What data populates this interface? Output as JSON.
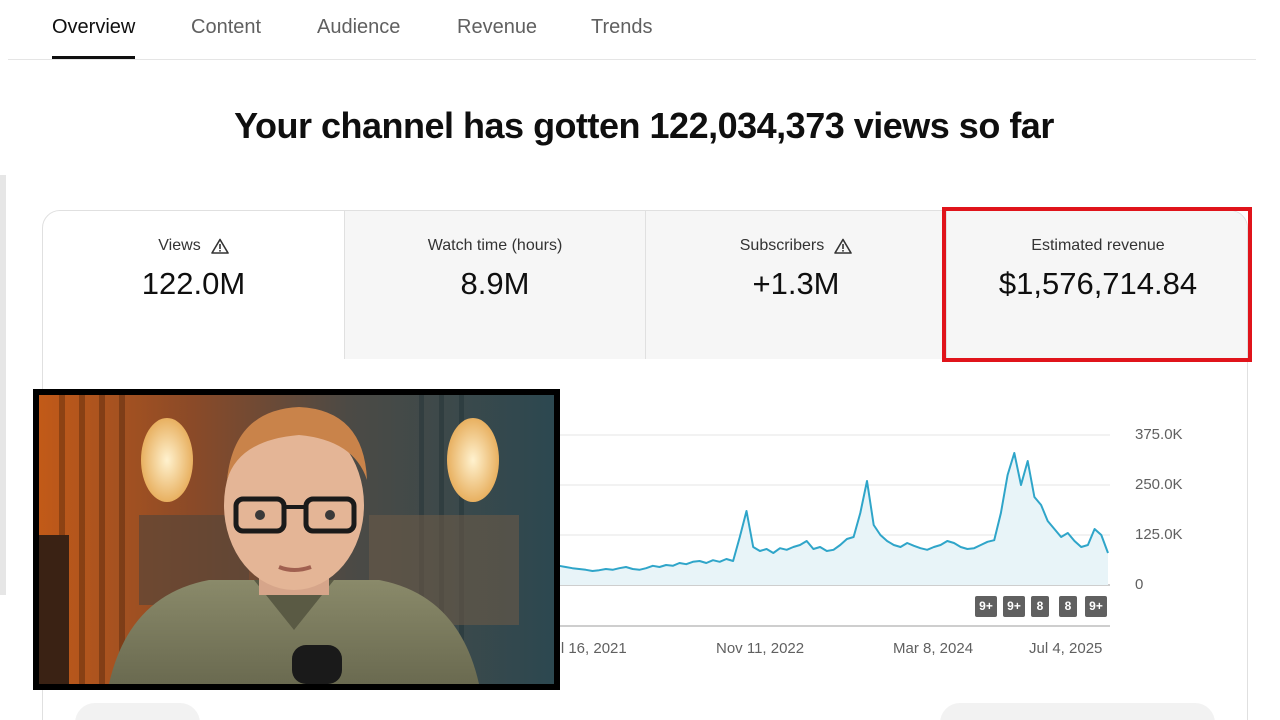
{
  "tabs": [
    {
      "label": "Overview",
      "active": true
    },
    {
      "label": "Content",
      "active": false
    },
    {
      "label": "Audience",
      "active": false
    },
    {
      "label": "Revenue",
      "active": false
    },
    {
      "label": "Trends",
      "active": false
    }
  ],
  "headline": "Your channel has gotten 122,034,373 views so far",
  "metrics": [
    {
      "label": "Views",
      "value": "122.0M",
      "warning": true
    },
    {
      "label": "Watch time (hours)",
      "value": "8.9M",
      "warning": false
    },
    {
      "label": "Subscribers",
      "value": "+1.3M",
      "warning": true
    },
    {
      "label": "Estimated revenue",
      "value": "$1,576,714.84",
      "warning": false
    }
  ],
  "highlight_color": "#e0141b",
  "chart_data": {
    "type": "area",
    "y_ticks": [
      "375.0K",
      "250.0K",
      "125.0K",
      "0"
    ],
    "x_ticks": [
      "Jul 16, 2021",
      "Nov 11, 2022",
      "Mar 8, 2024",
      "Jul 4, 2025"
    ],
    "ylim": [
      0,
      375000
    ],
    "series_color": "#2fa5c9",
    "fill_color": "#e8f4f8",
    "values": [
      60000,
      58000,
      62000,
      55000,
      60000,
      63000,
      58000,
      52000,
      55000,
      60000,
      57000,
      54000,
      50000,
      48000,
      45000,
      42000,
      40000,
      38000,
      35000,
      37000,
      40000,
      38000,
      42000,
      45000,
      40000,
      38000,
      42000,
      48000,
      45000,
      50000,
      48000,
      55000,
      52000,
      58000,
      60000,
      55000,
      62000,
      58000,
      65000,
      60000,
      120000,
      185000,
      95000,
      85000,
      90000,
      80000,
      92000,
      88000,
      95000,
      100000,
      110000,
      90000,
      95000,
      85000,
      88000,
      100000,
      115000,
      120000,
      180000,
      260000,
      150000,
      125000,
      110000,
      100000,
      95000,
      105000,
      98000,
      92000,
      88000,
      95000,
      100000,
      110000,
      105000,
      95000,
      90000,
      92000,
      100000,
      108000,
      112000,
      180000,
      275000,
      330000,
      250000,
      310000,
      220000,
      200000,
      160000,
      140000,
      120000,
      130000,
      110000,
      95000,
      100000,
      140000,
      125000,
      80000
    ],
    "badges": [
      "9+",
      "9+",
      "8",
      "8",
      "9+"
    ]
  }
}
